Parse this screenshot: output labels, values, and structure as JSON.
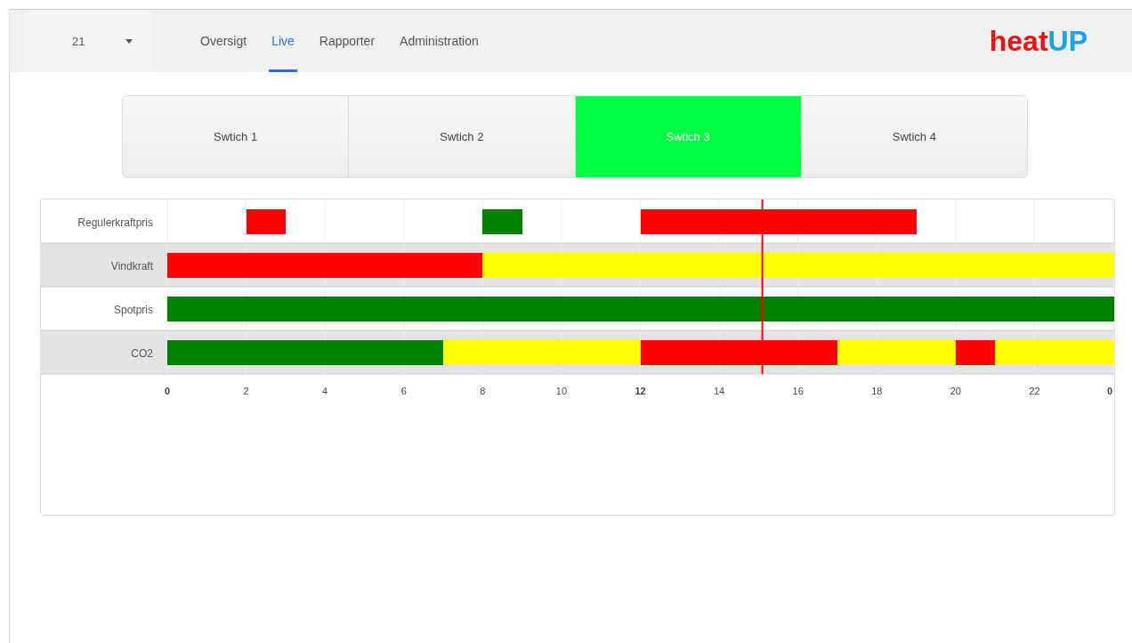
{
  "selector": {
    "value": "21"
  },
  "nav": [
    {
      "label": "Oversigt",
      "selected": false
    },
    {
      "label": "Live",
      "selected": true
    },
    {
      "label": "Rapporter",
      "selected": false
    },
    {
      "label": "Administration",
      "selected": false
    }
  ],
  "logo": {
    "part_1": "heat",
    "part_2": "UP"
  },
  "switches": [
    {
      "label": "Swtich 1",
      "selected": false
    },
    {
      "label": "Swtich 2",
      "selected": false
    },
    {
      "label": "Swtich 3",
      "selected": true
    },
    {
      "label": "Swtich 4",
      "selected": false
    }
  ],
  "timeline": {
    "rows": [
      {
        "label": "Regulerkraftpris",
        "hours": [
          {
            "kind": "empty"
          },
          {
            "kind": "empty"
          },
          {
            "kind": "bar",
            "color": "#ff0000"
          },
          {
            "kind": "empty"
          },
          {
            "kind": "empty"
          },
          {
            "kind": "empty"
          },
          {
            "kind": "empty"
          },
          {
            "kind": "empty"
          },
          {
            "kind": "bar",
            "color": "#008000"
          },
          {
            "kind": "empty"
          },
          {
            "kind": "empty"
          },
          {
            "kind": "empty"
          },
          {
            "kind": "bar",
            "color": "#ff0000"
          },
          {
            "kind": "bar",
            "color": "#ff0000"
          },
          {
            "kind": "bar",
            "color": "#ff0000"
          },
          {
            "kind": "bar",
            "color": "#ff0000"
          },
          {
            "kind": "bar",
            "color": "#ff0000"
          },
          {
            "kind": "bar",
            "color": "#ff0000"
          },
          {
            "kind": "bar",
            "color": "#ff0000"
          },
          {
            "kind": "empty"
          },
          {
            "kind": "empty"
          },
          {
            "kind": "empty"
          },
          {
            "kind": "empty"
          },
          {
            "kind": "empty"
          }
        ]
      },
      {
        "label": "Vindkraft",
        "hours": [
          {
            "kind": "bar",
            "color": "#ff0000"
          },
          {
            "kind": "bar",
            "color": "#ff0000"
          },
          {
            "kind": "bar",
            "color": "#ff0000"
          },
          {
            "kind": "bar",
            "color": "#ff0000"
          },
          {
            "kind": "bar",
            "color": "#ff0000"
          },
          {
            "kind": "bar",
            "color": "#ff0000"
          },
          {
            "kind": "bar",
            "color": "#ff0000"
          },
          {
            "kind": "bar",
            "color": "#ff0000"
          },
          {
            "kind": "bar",
            "color": "#ffff00"
          },
          {
            "kind": "bar",
            "color": "#ffff00"
          },
          {
            "kind": "bar",
            "color": "#ffff00"
          },
          {
            "kind": "bar",
            "color": "#ffff00"
          },
          {
            "kind": "bar",
            "color": "#ffff00"
          },
          {
            "kind": "bar",
            "color": "#ffff00"
          },
          {
            "kind": "bar",
            "color": "#ffff00"
          },
          {
            "kind": "bar",
            "color": "#ffff00"
          },
          {
            "kind": "bar",
            "color": "#ffff00"
          },
          {
            "kind": "bar",
            "color": "#ffff00"
          },
          {
            "kind": "bar",
            "color": "#ffff00"
          },
          {
            "kind": "bar",
            "color": "#ffff00"
          },
          {
            "kind": "bar",
            "color": "#ffff00"
          },
          {
            "kind": "bar",
            "color": "#ffff00"
          },
          {
            "kind": "bar",
            "color": "#ffff00"
          },
          {
            "kind": "bar",
            "color": "#ffff00"
          }
        ]
      },
      {
        "label": "Spotpris",
        "hours": [
          {
            "kind": "bar",
            "color": "#008000"
          },
          {
            "kind": "bar",
            "color": "#008000"
          },
          {
            "kind": "bar",
            "color": "#008000"
          },
          {
            "kind": "bar",
            "color": "#008000"
          },
          {
            "kind": "bar",
            "color": "#008000"
          },
          {
            "kind": "bar",
            "color": "#008000"
          },
          {
            "kind": "bar",
            "color": "#008000"
          },
          {
            "kind": "bar",
            "color": "#008000"
          },
          {
            "kind": "bar",
            "color": "#008000"
          },
          {
            "kind": "bar",
            "color": "#008000"
          },
          {
            "kind": "bar",
            "color": "#008000"
          },
          {
            "kind": "bar",
            "color": "#008000"
          },
          {
            "kind": "bar",
            "color": "#008000"
          },
          {
            "kind": "bar",
            "color": "#008000"
          },
          {
            "kind": "bar",
            "color": "#008000"
          },
          {
            "kind": "bar",
            "color": "#008000"
          },
          {
            "kind": "bar",
            "color": "#008000"
          },
          {
            "kind": "bar",
            "color": "#008000"
          },
          {
            "kind": "bar",
            "color": "#008000"
          },
          {
            "kind": "bar",
            "color": "#008000"
          },
          {
            "kind": "bar",
            "color": "#008000"
          },
          {
            "kind": "bar",
            "color": "#008000"
          },
          {
            "kind": "bar",
            "color": "#008000"
          },
          {
            "kind": "bar",
            "color": "#008000"
          }
        ]
      },
      {
        "label": "CO2",
        "hours": [
          {
            "kind": "bar",
            "color": "#008000"
          },
          {
            "kind": "bar",
            "color": "#008000"
          },
          {
            "kind": "bar",
            "color": "#008000"
          },
          {
            "kind": "bar",
            "color": "#008000"
          },
          {
            "kind": "bar",
            "color": "#008000"
          },
          {
            "kind": "bar",
            "color": "#008000"
          },
          {
            "kind": "bar",
            "color": "#008000"
          },
          {
            "kind": "bar",
            "color": "#ffff00"
          },
          {
            "kind": "bar",
            "color": "#ffff00"
          },
          {
            "kind": "bar",
            "color": "#ffff00"
          },
          {
            "kind": "bar",
            "color": "#ffff00"
          },
          {
            "kind": "bar",
            "color": "#ffff00"
          },
          {
            "kind": "bar",
            "color": "#ff0000"
          },
          {
            "kind": "bar",
            "color": "#ff0000"
          },
          {
            "kind": "bar",
            "color": "#ff0000"
          },
          {
            "kind": "bar",
            "color": "#ff0000"
          },
          {
            "kind": "bar",
            "color": "#ff0000"
          },
          {
            "kind": "bar",
            "color": "#ffff00"
          },
          {
            "kind": "bar",
            "color": "#ffff00"
          },
          {
            "kind": "bar",
            "color": "#ffff00"
          },
          {
            "kind": "bar",
            "color": "#ff0000"
          },
          {
            "kind": "bar",
            "color": "#ffff00"
          },
          {
            "kind": "bar",
            "color": "#ffff00"
          },
          {
            "kind": "bar",
            "color": "#ffff00"
          }
        ]
      }
    ],
    "axis_labels": [
      "0",
      "2",
      "4",
      "6",
      "8",
      "10",
      "12",
      "14",
      "16",
      "18",
      "20",
      "22",
      "0"
    ],
    "now_marker": {
      "level": 0.629
    }
  }
}
